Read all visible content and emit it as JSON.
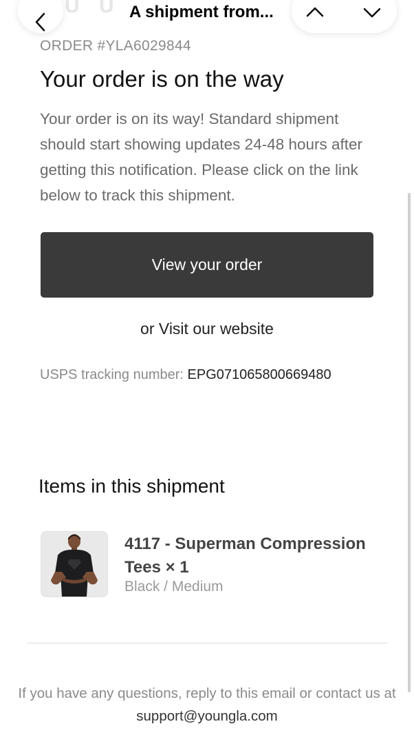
{
  "header": {
    "subject": "A shipment from...",
    "back_icon": "chevron-left-icon",
    "prev_icon": "chevron-up-icon",
    "next_icon": "chevron-down-icon"
  },
  "email": {
    "order_number": "ORDER #YLA6029844",
    "headline": "Your order is on the way",
    "intro": "Your order is on its way! Standard shipment should start showing updates 24-48 hours after getting this notification. Please click on the link below to track this shipment.",
    "cta_label": "View your order",
    "visit_label": "or Visit our website",
    "tracking_label": "USPS tracking number: ",
    "tracking_number": "EPG071065800669480",
    "items_title": "Items in this shipment",
    "item": {
      "name": "4117 - Superman Compression Tees × 1",
      "variant": "Black / Medium"
    },
    "footer_text": "If you have any questions, reply to this email or contact us at ",
    "support_email": "support@youngla.com"
  },
  "colors": {
    "cta_background": "#3a3a3a",
    "muted_text": "#8a8a8a"
  }
}
